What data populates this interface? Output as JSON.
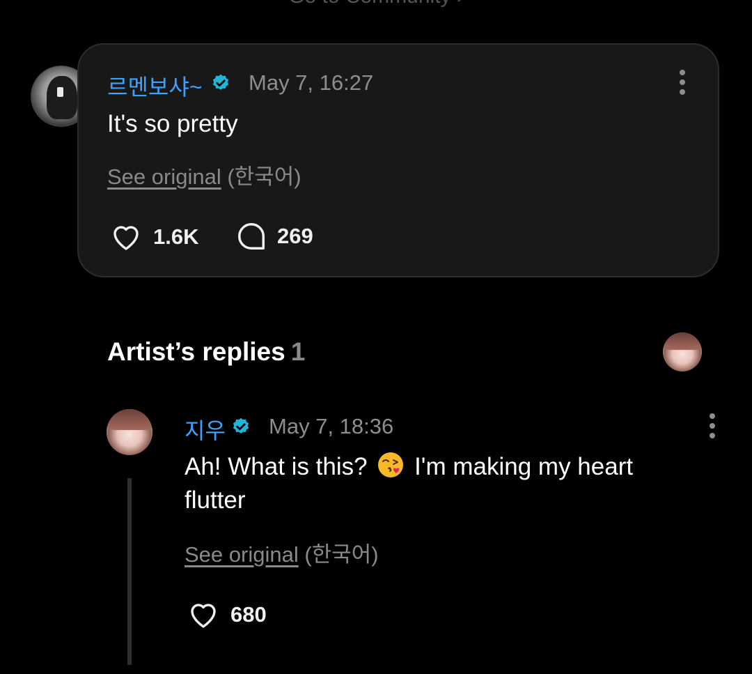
{
  "header": {
    "link_text": "Go to Community  ›"
  },
  "comment": {
    "username": "르멘보샤~",
    "timestamp": "May 7, 16:27",
    "text": "It's so pretty",
    "see_original": "See original",
    "language": "(한국어)",
    "likes": "1.6K",
    "replies": "269",
    "verified_color": "#1fb7d9"
  },
  "artist_replies": {
    "title": "Artist’s replies",
    "count": "1",
    "reply": {
      "username": "지우",
      "timestamp": "May 7, 18:36",
      "text_before": "Ah! What is this?",
      "emoji": "kissing-face-emoji",
      "text_after": "I'm making my heart flutter",
      "see_original": "See original",
      "language": "(한국어)",
      "likes": "680"
    }
  },
  "colors": {
    "background": "#000000",
    "card": "#181818",
    "username": "#3ba3ff",
    "muted": "#8e8e8e"
  }
}
